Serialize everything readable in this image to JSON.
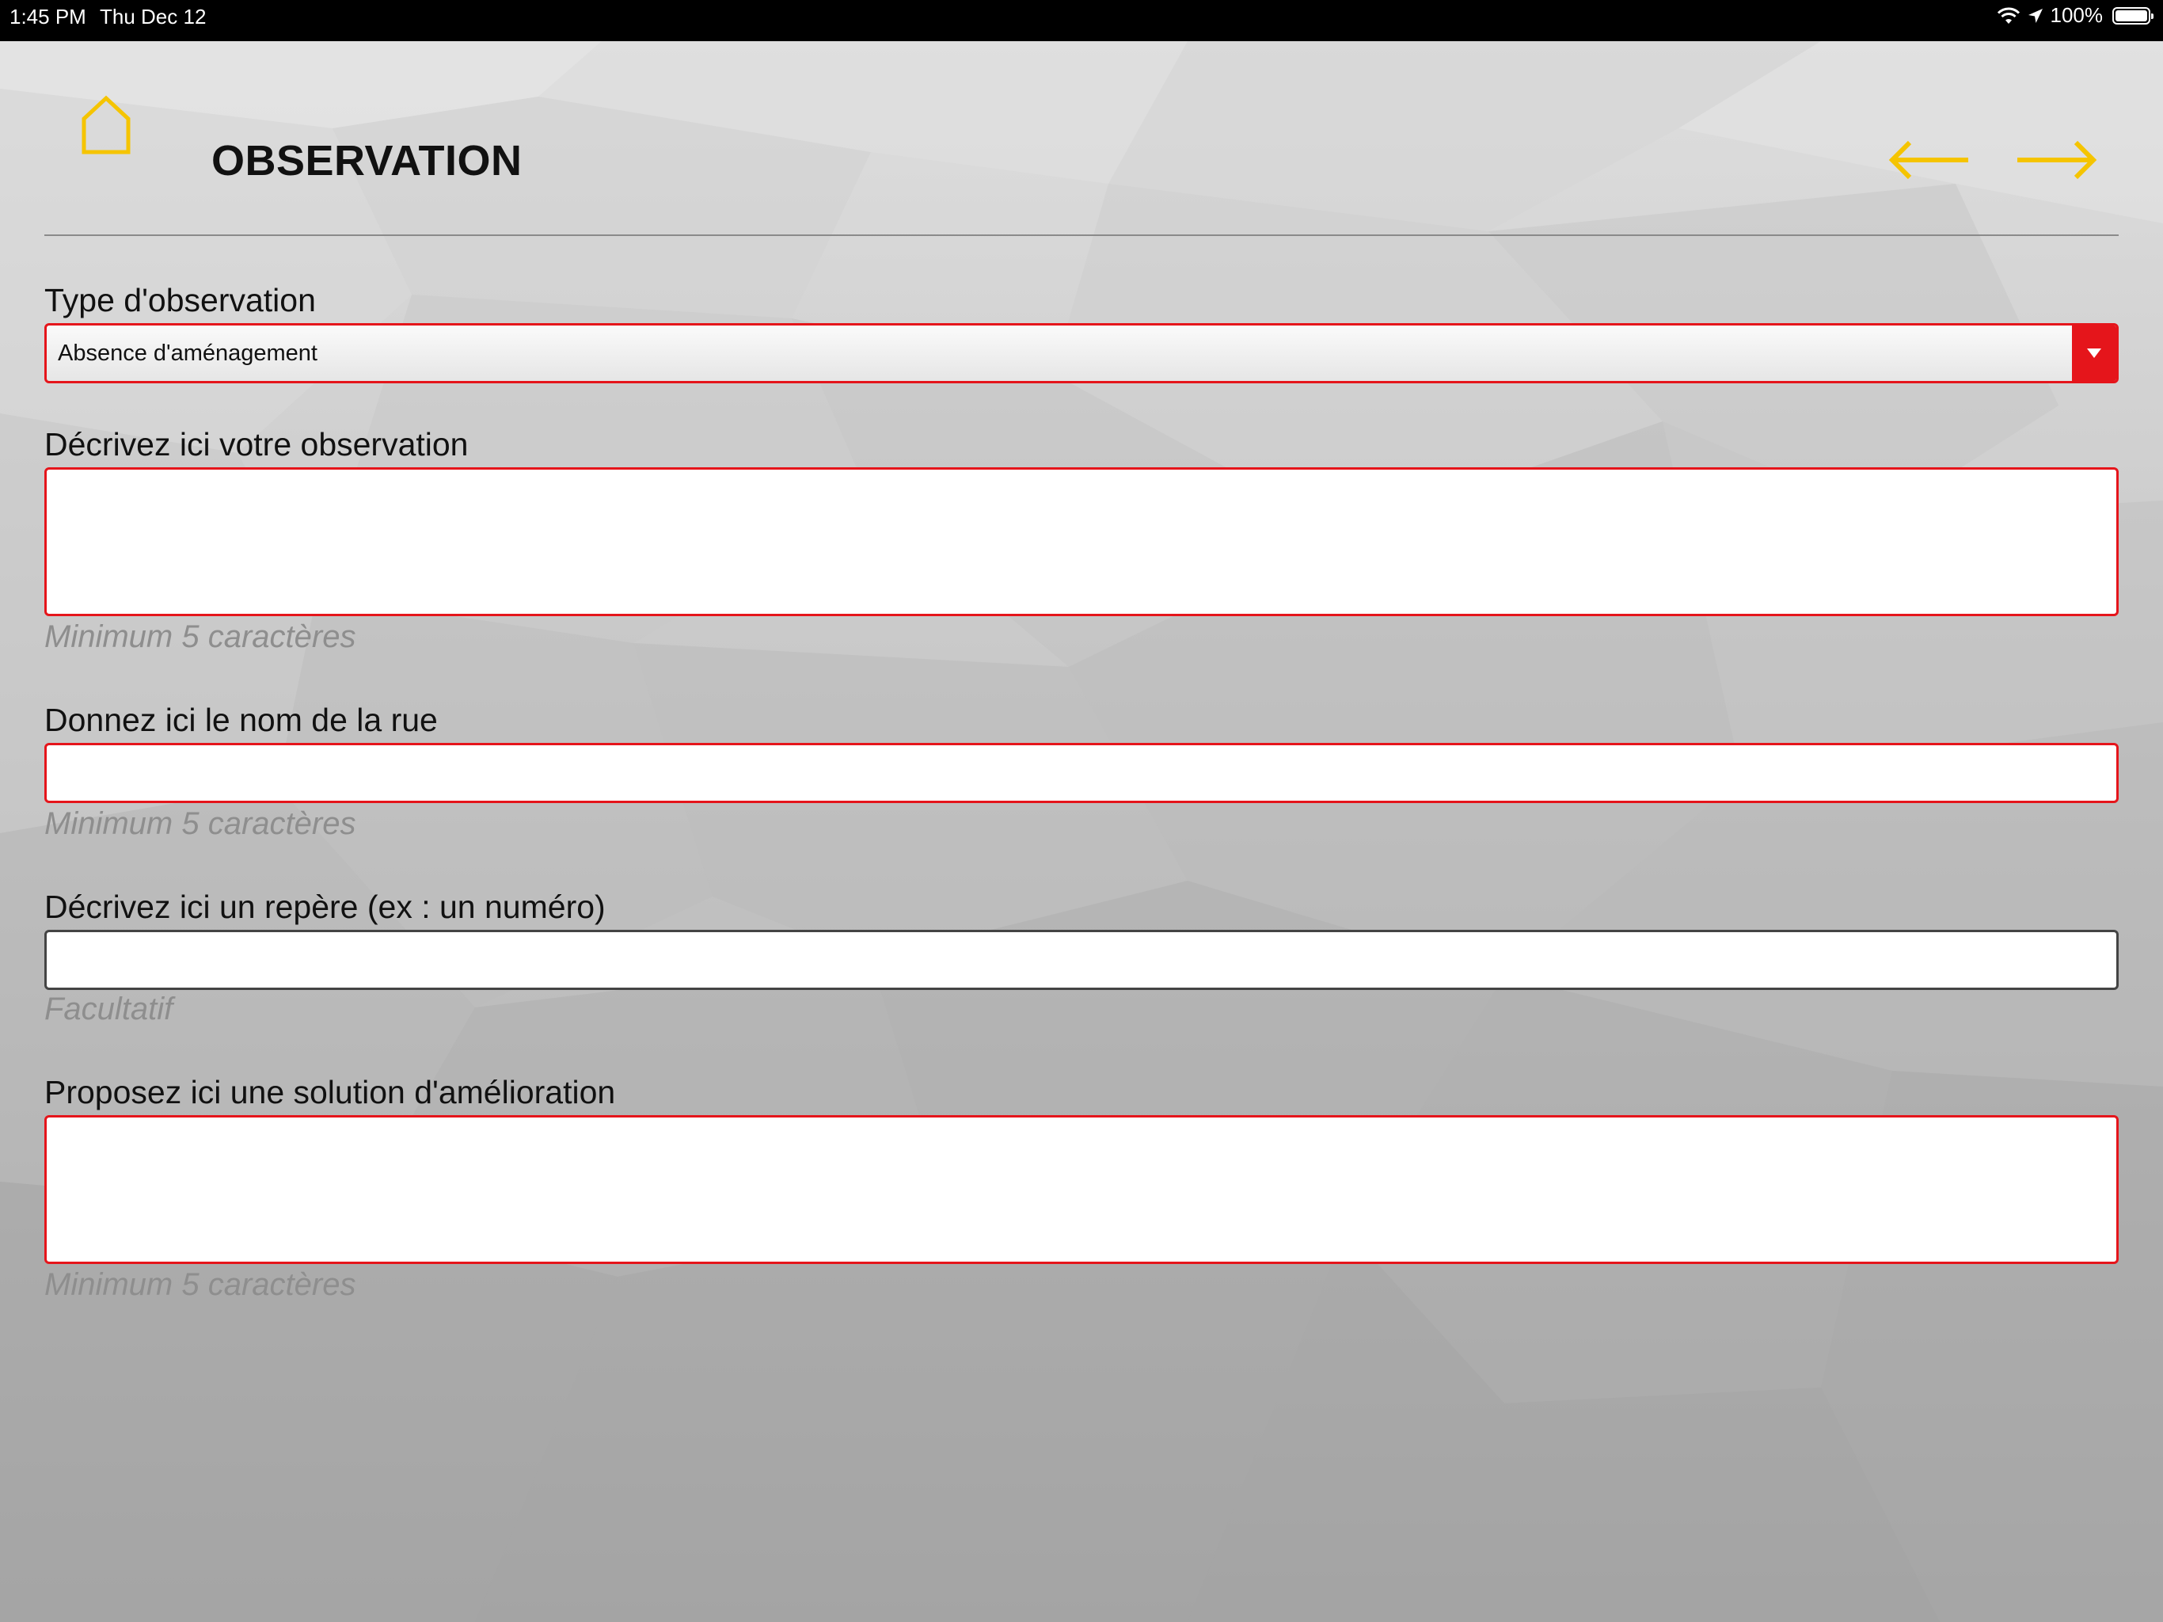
{
  "status_bar": {
    "time": "1:45 PM",
    "date": "Thu Dec 12",
    "battery": "100%"
  },
  "header": {
    "title": "OBSERVATION",
    "home_icon": "home-icon",
    "back_icon": "arrow-left-icon",
    "forward_icon": "arrow-right-icon",
    "accent_color": "#f5c400"
  },
  "form": {
    "type": {
      "label": "Type d'observation",
      "value": "Absence d'aménagement"
    },
    "description": {
      "label": "Décrivez ici votre observation",
      "value": "",
      "helper": "Minimum 5 caractères"
    },
    "street": {
      "label": "Donnez ici le nom de la rue",
      "value": "",
      "helper": "Minimum 5 caractères"
    },
    "landmark": {
      "label": "Décrivez ici un repère (ex : un numéro)",
      "value": "",
      "helper": "Facultatif"
    },
    "solution": {
      "label": "Proposez ici une solution d'amélioration",
      "value": "",
      "helper": "Minimum 5 caractères"
    },
    "error_color": "#e5151b"
  }
}
